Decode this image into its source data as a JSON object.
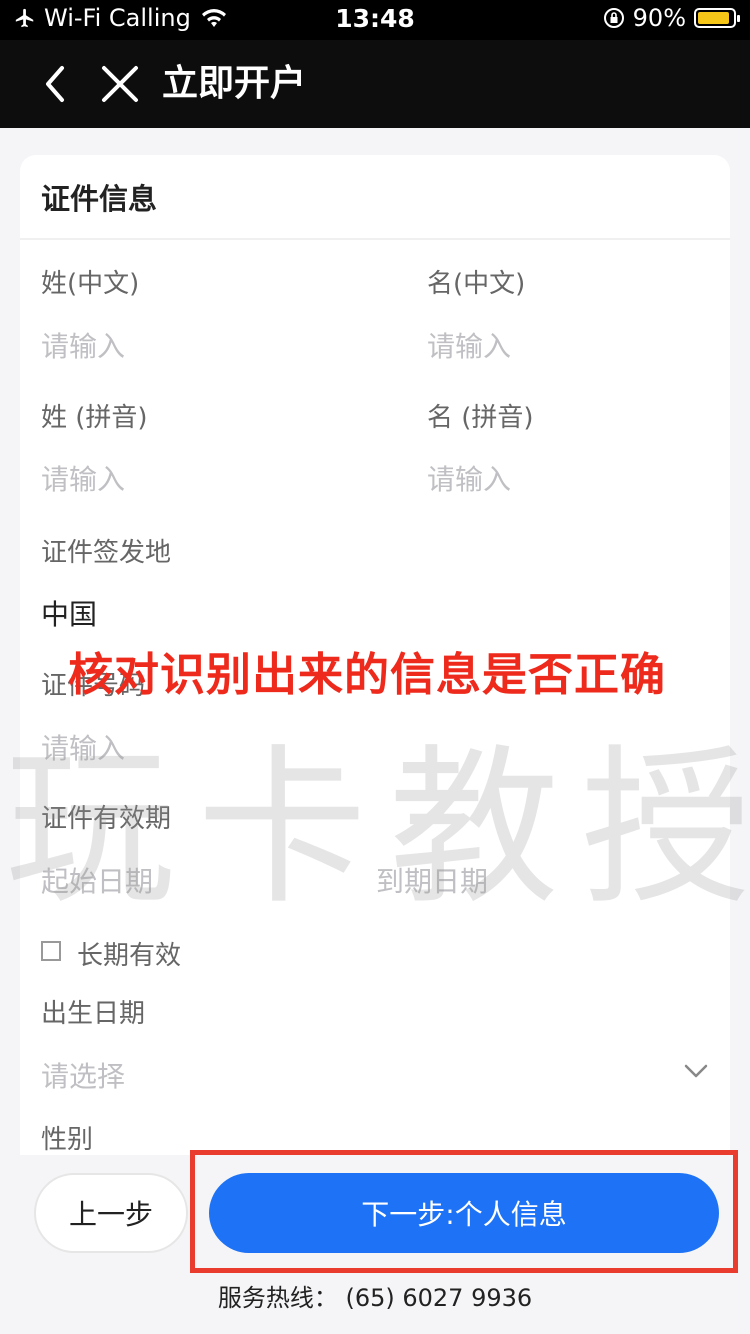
{
  "status": {
    "carrier": "Wi-Fi Calling",
    "time": "13:48",
    "battery": "90%",
    "battery_level": 0.9
  },
  "nav": {
    "title": "立即开户"
  },
  "form": {
    "section_title": "证件信息",
    "last_name_cn_label": "姓(中文)",
    "first_name_cn_label": "名(中文)",
    "last_name_pinyin_label": "姓 (拼音)",
    "first_name_pinyin_label": "名 (拼音)",
    "placeholder": "请输入",
    "issuing_place_label": "证件签发地",
    "issuing_place_value": "中国",
    "id_number_label": "证件号码",
    "validity_label": "证件有效期",
    "start_date_placeholder": "起始日期",
    "end_date_placeholder": "到期日期",
    "long_term_label": "长期有效",
    "birth_date_label": "出生日期",
    "select_placeholder": "请选择",
    "gender_label": "性别"
  },
  "annotation": "核对识别出来的信息是否正确",
  "watermark": "玩卡教授",
  "buttons": {
    "prev": "上一步",
    "next": "下一步:个人信息"
  },
  "hotline": "服务热线： (65) 6027 9936"
}
